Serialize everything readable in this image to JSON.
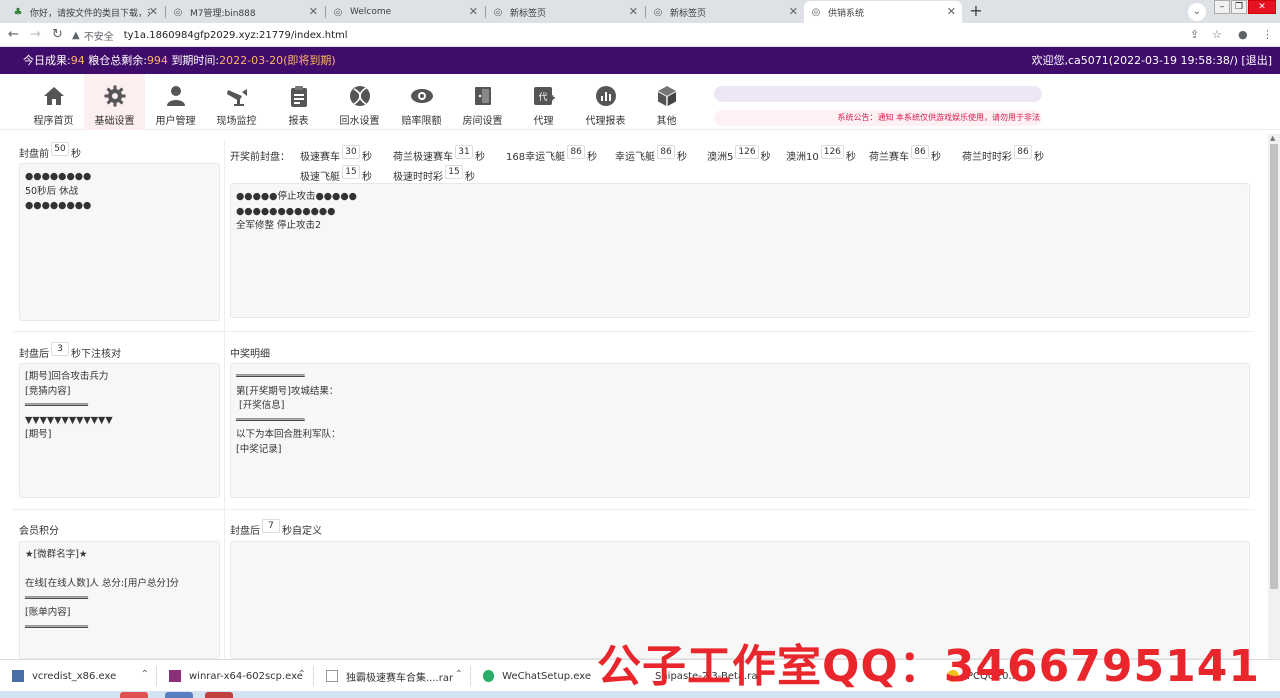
{
  "browser": {
    "tabs": [
      {
        "label": "你好，请按文件的类目下载，对...",
        "icon": "tree-icon"
      },
      {
        "label": "M7管理:bin888",
        "icon": "globe-icon"
      },
      {
        "label": "Welcome",
        "icon": "globe-icon"
      },
      {
        "label": "新标签页",
        "icon": "globe-icon"
      },
      {
        "label": "新标签页",
        "icon": "globe-icon"
      },
      {
        "label": "供销系统",
        "icon": "globe-icon"
      }
    ],
    "insecure_label": "不安全",
    "url": "ty1a.1860984gfp2029.xyz:21779/index.html"
  },
  "header": {
    "today_label": "今日成果:",
    "today_value": "94",
    "stock_label": "粮仓总剩余:",
    "stock_value": "994",
    "expire_label": "到期时间:",
    "expire_value": "2022-03-20(即将到期)",
    "welcome": "欢迎您,ca5071(2022-03-19 19:58:38/) [退出]"
  },
  "nav": [
    {
      "label": "程序首页",
      "icon": "home-icon"
    },
    {
      "label": "基础设置",
      "icon": "gear-icon",
      "active": true
    },
    {
      "label": "用户管理",
      "icon": "user-icon"
    },
    {
      "label": "现场监控",
      "icon": "camera-icon"
    },
    {
      "label": "报表",
      "icon": "clipboard-icon"
    },
    {
      "label": "回水设置",
      "icon": "ball-icon"
    },
    {
      "label": "赔率限额",
      "icon": "eye-icon"
    },
    {
      "label": "房间设置",
      "icon": "door-icon"
    },
    {
      "label": "代理",
      "icon": "agent-icon"
    },
    {
      "label": "代理报表",
      "icon": "chart-icon"
    },
    {
      "label": "其他",
      "icon": "box-icon"
    }
  ],
  "notice": "系统公告：通知 本系统仅供游戏娱乐使用，请勿用于非法",
  "sections": {
    "pre_close": {
      "label_before": "封盘前",
      "seconds": "50",
      "label_after": "秒",
      "text": "●●●●●●●●\n50秒后 休战\n●●●●●●●●"
    },
    "open_pre_close": {
      "label": "开奖前封盘：",
      "unit": "秒",
      "items": [
        {
          "name": "极速赛车",
          "seconds": "30"
        },
        {
          "name": "荷兰极速赛车",
          "seconds": "31"
        },
        {
          "name": "168幸运飞艇",
          "seconds": "86"
        },
        {
          "name": "幸运飞艇",
          "seconds": "86"
        },
        {
          "name": "澳洲5",
          "seconds": "126"
        },
        {
          "name": "澳洲10",
          "seconds": "126"
        },
        {
          "name": "荷兰赛车",
          "seconds": "86"
        },
        {
          "name": "荷兰时时彩",
          "seconds": "86"
        },
        {
          "name": "极速飞艇",
          "seconds": "15"
        },
        {
          "name": "极速时时彩",
          "seconds": "15"
        }
      ],
      "text": "●●●●●停止攻击●●●●●\n●●●●●●●●●●●●\n全军修整 停止攻击2"
    },
    "post_close_check": {
      "label_before": "封盘后",
      "seconds": "3",
      "label_after": "秒下注核对",
      "text": "[期号]回合攻击兵力\n[竞猜内容]\n═══════════\n▼▼▼▼▼▼▼▼▼▼▼▼\n[期号]"
    },
    "prize_detail": {
      "label": "中奖明细",
      "text": "════════════\n第[开奖期号]攻城结果：\n [开奖信息]\n════════════\n以下为本回合胜利军队：\n[中奖记录]"
    },
    "member_points": {
      "label": "会员积分",
      "text": "★[微群名字]★\n\n在线[在线人数]人 总分:[用户总分]分\n═══════════\n[账单内容]\n═══════════"
    },
    "post_close_custom": {
      "label_before": "封盘后",
      "seconds": "7",
      "label_after": "秒自定义",
      "text": ""
    }
  },
  "downloads": [
    {
      "name": "vcredist_x86.exe"
    },
    {
      "name": "winrar-x64-602scp.exe"
    },
    {
      "name": "独霸极速赛车合集....rar"
    },
    {
      "name": "WeChatSetup.exe"
    },
    {
      "name": "Snipaste-2.3-Beta.rar"
    },
    {
      "name": "PCQQ20..."
    }
  ],
  "watermark": "公子工作室QQ：3466795141"
}
